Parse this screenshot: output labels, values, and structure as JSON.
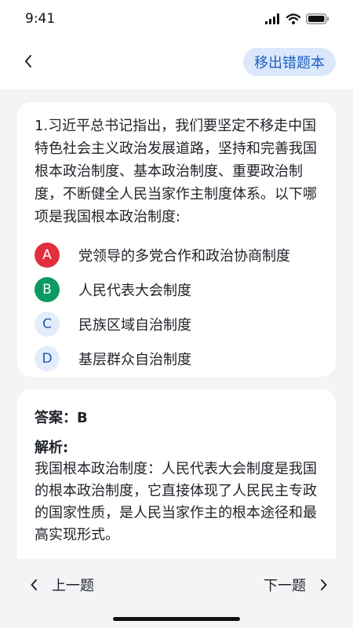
{
  "status_bar": {
    "time": "9:41"
  },
  "header": {
    "back_icon": "chevron-left-icon",
    "remove_label": "移出错题本"
  },
  "question": {
    "text": "1.习近平总书记指出，我们要坚定不移走中国特色社会主义政治发展道路，坚持和完善我国根本政治制度、基本政治制度、重要政治制度，不断健全人民当家作主制度体系。以下哪项是我国根本政治制度:",
    "options": [
      {
        "letter": "A",
        "text": "党领导的多党合作和政治协商制度",
        "state": "wrong",
        "color": "#e0303e"
      },
      {
        "letter": "B",
        "text": "人民代表大会制度",
        "state": "correct",
        "color": "#0d9a62"
      },
      {
        "letter": "C",
        "text": "民族区域自治制度",
        "state": "neutral",
        "color": "#e3ecfb"
      },
      {
        "letter": "D",
        "text": "基层群众自治制度",
        "state": "neutral",
        "color": "#e3ecfb"
      }
    ]
  },
  "answer": {
    "line": "答案：B",
    "analysis_title": "解析:",
    "analysis_text": "我国根本政治制度：人民代表大会制度是我国的根本政治制度，它直接体现了人民民主专政的国家性质，是人民当家作主的根本途径和最高实现形式。"
  },
  "footer": {
    "prev_label": "上一题",
    "next_label": "下一题"
  },
  "colors": {
    "accent": "#1d5fc4",
    "accent_bg": "#dbe8fb",
    "wrong": "#e0303e",
    "correct": "#0d9a62"
  }
}
